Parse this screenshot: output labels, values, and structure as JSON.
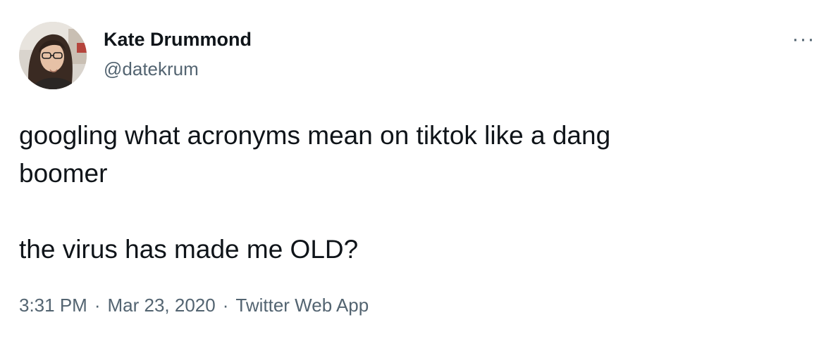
{
  "author": {
    "name": "Kate Drummond",
    "handle": "@datekrum"
  },
  "tweet": {
    "lines": [
      "googling what acronyms mean on tiktok like a dang",
      "boomer",
      "the virus has made me OLD?"
    ]
  },
  "meta": {
    "time": "3:31 PM",
    "separator": "·",
    "date": "Mar 23, 2020",
    "source": "Twitter Web App"
  },
  "menu": {
    "more_icon": "more-horizontal-icon",
    "more_label": "···"
  },
  "colors": {
    "text_primary": "#0f1419",
    "text_secondary": "#536471",
    "background": "#ffffff"
  }
}
